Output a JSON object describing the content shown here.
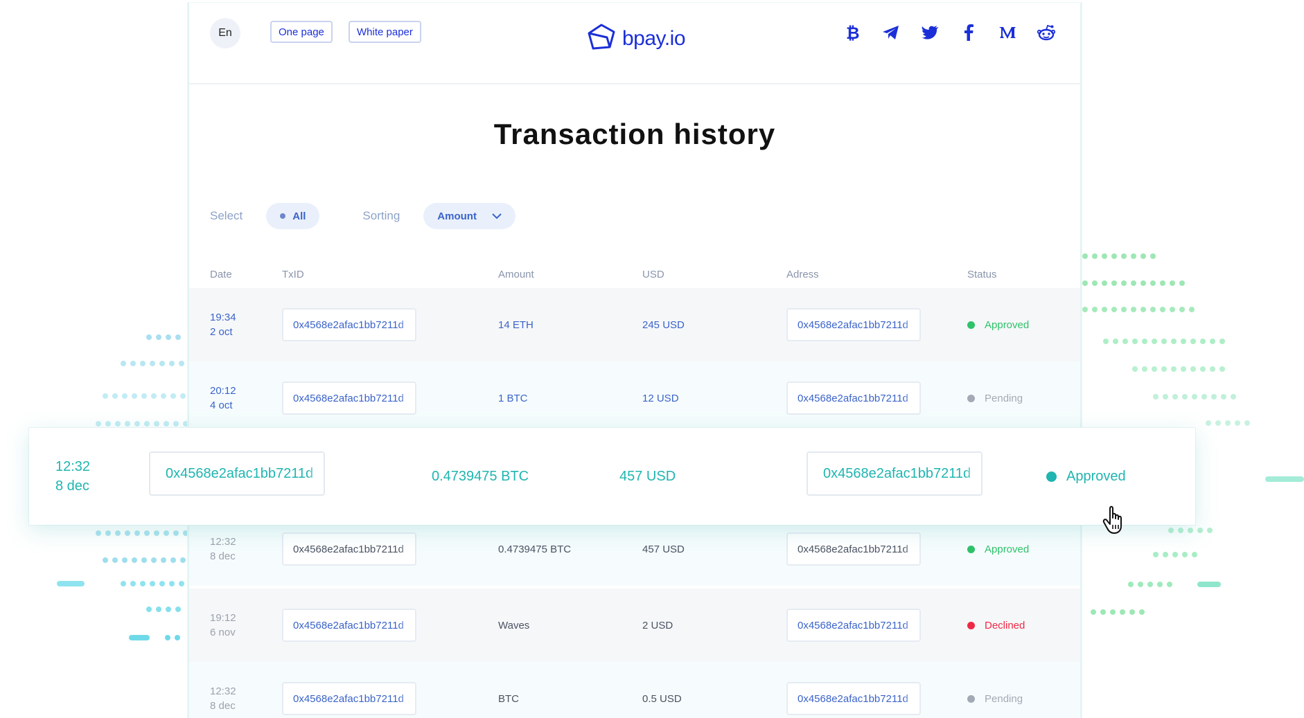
{
  "topbar": {
    "lang": "En",
    "one_page": "One page",
    "white_paper": "White paper",
    "logo_text": "bpay.io",
    "socials": [
      "bitcoin-icon",
      "telegram-icon",
      "twitter-icon",
      "facebook-icon",
      "medium-icon",
      "reddit-icon"
    ]
  },
  "page": {
    "title": "Transaction history"
  },
  "filters": {
    "select_label": "Select",
    "select_value": "All",
    "sorting_label": "Sorting",
    "sorting_value": "Amount"
  },
  "table": {
    "headers": {
      "date": "Date",
      "txid": "TxID",
      "amount": "Amount",
      "usd": "USD",
      "address": "Adress",
      "status": "Status"
    },
    "rows": [
      {
        "time": "19:34",
        "day": "2 oct",
        "txid": "0x4568e2afac1bb7211d",
        "amount": "14 ETH",
        "usd": "245 USD",
        "address": "0x4568e2afac1bb7211d",
        "status": "Approved"
      },
      {
        "time": "20:12",
        "day": "4 oct",
        "txid": "0x4568e2afac1bb7211d",
        "amount": "1 BTC",
        "usd": "12 USD",
        "address": "0x4568e2afac1bb7211d",
        "status": "Pending"
      },
      {
        "time": "12:32",
        "day": "8 dec",
        "txid": "0x4568e2afac1bb7211d",
        "amount": "0.4739475 BTC",
        "usd": "457 USD",
        "address": "0x4568e2afac1bb7211d",
        "status": "Approved"
      },
      {
        "time": "19:12",
        "day": "6 nov",
        "txid": "0x4568e2afac1bb7211d",
        "amount": "Waves",
        "usd": "2 USD",
        "address": "0x4568e2afac1bb7211d",
        "status": "Declined"
      },
      {
        "time": "12:32",
        "day": "8 dec",
        "txid": "0x4568e2afac1bb7211d",
        "amount": "BTC",
        "usd": "0.5 USD",
        "address": "0x4568e2afac1bb7211d",
        "status": "Pending"
      }
    ]
  },
  "highlight": {
    "time": "12:32",
    "day": "8 dec",
    "txid": "0x4568e2afac1bb7211d",
    "amount": "0.4739475 BTC",
    "usd": "457 USD",
    "address": "0x4568e2afac1bb7211d",
    "status": "Approved"
  },
  "colors": {
    "brand": "#1b2fd8",
    "accent_teal": "#1fb5b0",
    "approved": "#2ec26a",
    "pending": "#a3a9b5",
    "declined": "#ef2945",
    "link_blue": "#3a63c9"
  }
}
